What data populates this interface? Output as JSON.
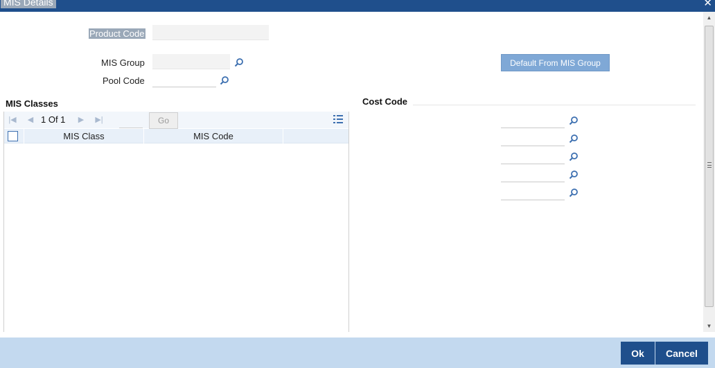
{
  "window": {
    "title": "MIS Details"
  },
  "form": {
    "product_code_label": "Product Code",
    "mis_group_label": "MIS Group",
    "pool_code_label": "Pool Code",
    "default_button_label": "Default From MIS Group"
  },
  "mis_classes": {
    "title": "MIS Classes",
    "pager_text": "1 Of 1",
    "go_label": "Go",
    "columns": [
      "MIS Class",
      "MIS Code",
      ""
    ]
  },
  "cost_code": {
    "title": "Cost Code",
    "field_count": 5
  },
  "footer": {
    "ok_label": "Ok",
    "cancel_label": "Cancel"
  },
  "icons": {
    "search": "search-icon",
    "close": "close-icon",
    "first_page": "first-page-icon",
    "previous_page": "previous-page-icon",
    "next_page": "next-page-icon",
    "last_page": "last-page-icon",
    "columns": "column-list-icon"
  },
  "colors": {
    "title_bar": "#1f4f8c",
    "accent_button": "#7fa8d6",
    "footer_bar": "#c3d9ef",
    "icon_blue": "#3c6fb0"
  }
}
